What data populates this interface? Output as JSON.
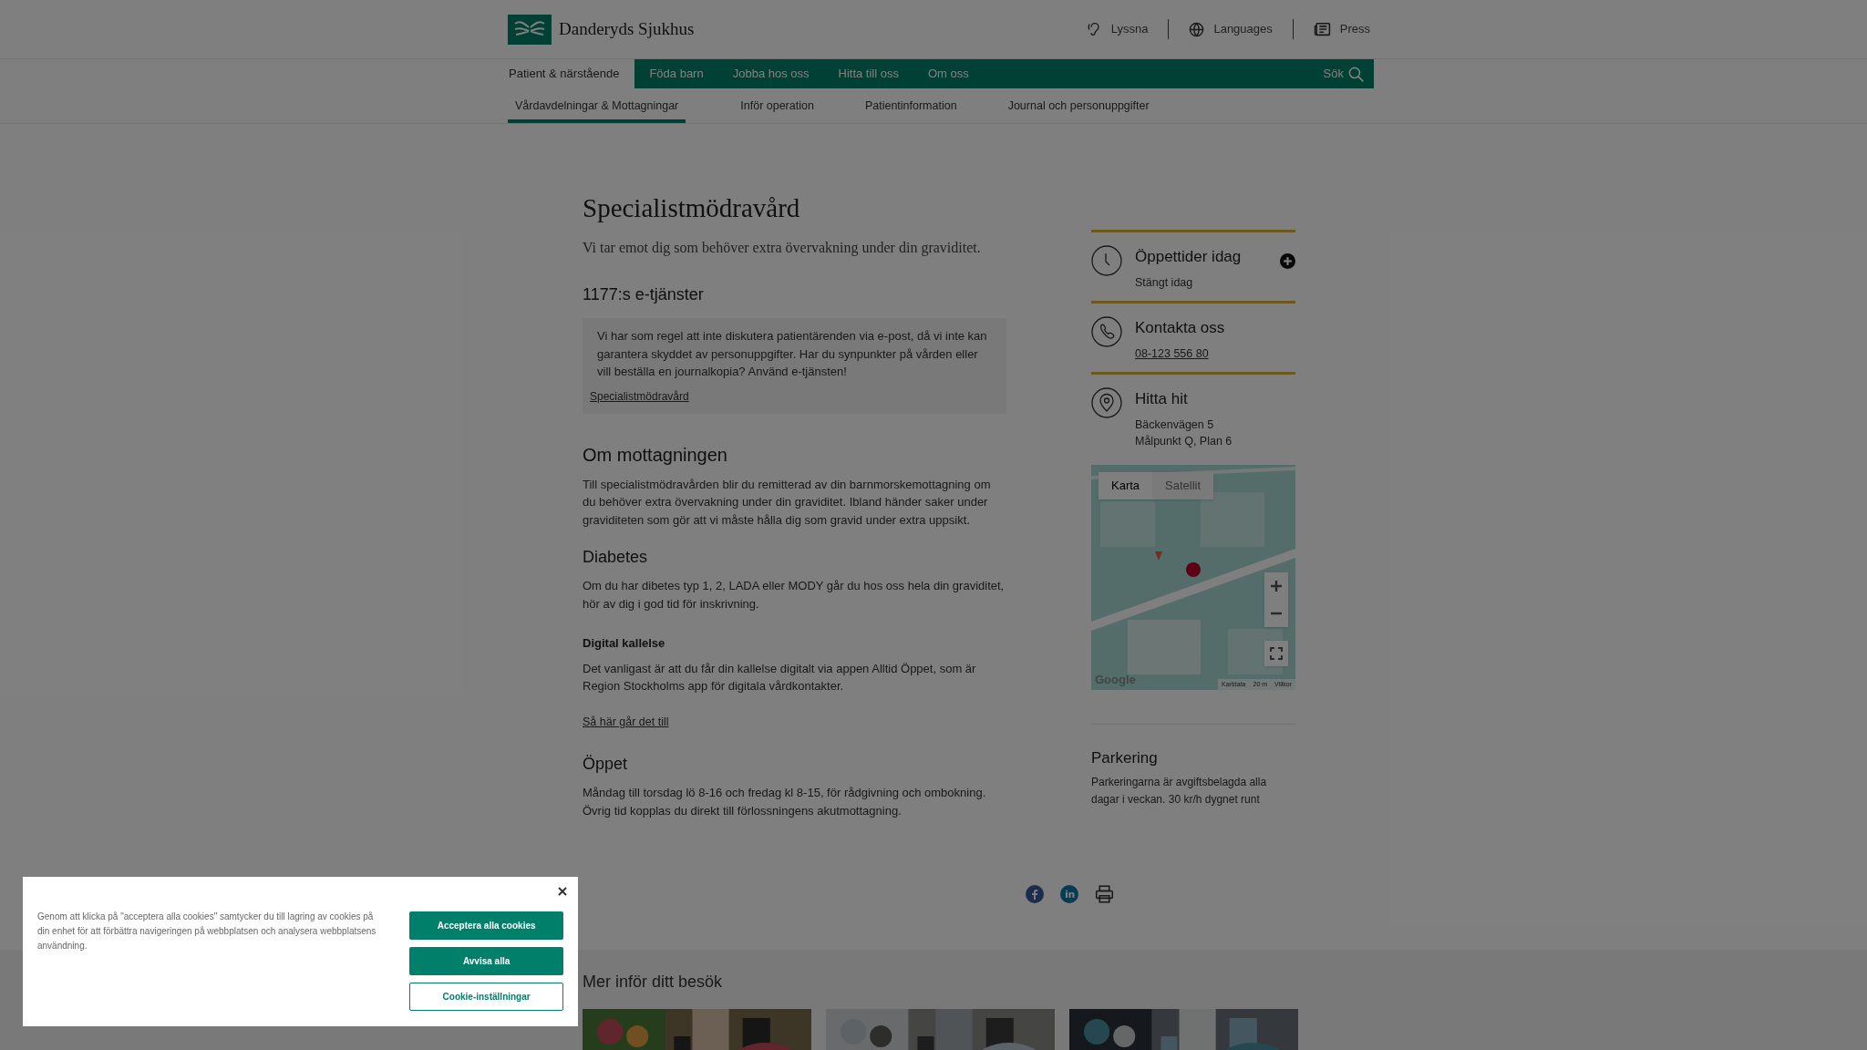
{
  "header": {
    "logo_text": "Danderyds Sjukhus",
    "utility_links": [
      {
        "kind": "ear",
        "label": "Lyssna"
      },
      {
        "kind": "globe",
        "label": "Languages"
      },
      {
        "kind": "newspaper",
        "label": "Press"
      }
    ]
  },
  "main_nav": {
    "items": [
      {
        "label": "Patient & närstående",
        "selected": true
      },
      {
        "label": "Föda barn",
        "selected": false
      },
      {
        "label": "Jobba hos oss",
        "selected": false
      },
      {
        "label": "Hitta till oss",
        "selected": false
      },
      {
        "label": "Om oss",
        "selected": false
      }
    ],
    "search_label": "Sök"
  },
  "sub_nav": {
    "items": [
      {
        "label": "Vårdavdelningar & Mottagningar",
        "selected": true
      },
      {
        "label": "Inför operation",
        "selected": false
      },
      {
        "label": "Patientinformation",
        "selected": false
      },
      {
        "label": "Journal och personuppgifter",
        "selected": false
      }
    ]
  },
  "article": {
    "title": "Specialistmödravård",
    "lead": "Vi tar emot dig som behöver extra övervakning under din graviditet.",
    "blocks": [
      {
        "kind": "h2",
        "text": "1177:s e-tjänster"
      },
      {
        "kind": "info_box",
        "text": "Vi har som regel att inte diskutera patientärenden via e-post, då vi inte kan garantera skyddet av personuppgifter. Har du synpunkter på vården eller vill beställa en journalkopia? Använd e-tjänsten!",
        "link": "Specialistmödravård"
      },
      {
        "kind": "h2",
        "text": "Om mottagningen"
      },
      {
        "kind": "p",
        "text": "Till specialistmödravården blir du remitterad av din barnmorskemottagning om du behöver extra övervakning under din graviditet. Ibland händer saker under graviditeten som gör att vi måste hålla dig som gravid under extra uppsikt."
      },
      {
        "kind": "h3",
        "text": "Diabetes"
      },
      {
        "kind": "p",
        "text": "Om du har dibetes typ 1, 2, LADA eller MODY går du hos oss hela din graviditet, hör av dig i god tid för inskrivning."
      },
      {
        "kind": "h4",
        "text": "Digital kallelse"
      },
      {
        "kind": "p",
        "text": "Det vanligast är att du får din kallelse digitalt via appen Alltid Öppet, som är Region Stockholms app för digitala vårdkontakter."
      },
      {
        "kind": "link",
        "text": "Så här går det till"
      },
      {
        "kind": "h3",
        "text": "Öppet"
      },
      {
        "kind": "p",
        "text": "Måndag till torsdag lö 8-16 och fredag kl 8-15, för rådgivning och ombokning. Övrig tid kopplas du direkt till förlossningens akutmottagning."
      }
    ]
  },
  "sidebar": {
    "cards": [
      {
        "kind": "hours",
        "title": "Öppettider idag",
        "lines": [
          "Stängt idag"
        ],
        "expanded": false
      },
      {
        "kind": "phone",
        "title": "Kontakta oss",
        "link": "08-123 556 80"
      },
      {
        "kind": "location",
        "title": "Hitta hit",
        "lines": [
          "Bäckenvägen 5",
          "Målpunkt Q, Plan 6"
        ]
      }
    ],
    "map": {
      "tabs": [
        {
          "label": "Karta",
          "selected": true
        },
        {
          "label": "Satellit",
          "selected": false
        }
      ],
      "logo": "Google",
      "attribution": [
        "Kartdata",
        "20 m",
        "Villkor"
      ]
    },
    "parking": {
      "title": "Parkering",
      "text": "Parkeringarna är avgiftsbelagda alla dagar i veckan. 30 kr/h dygnet runt"
    }
  },
  "related": {
    "title": "Mer inför ditt besök"
  },
  "cookie_banner": {
    "text": "Genom att klicka på \"acceptera alla cookies\" samtycker du till lagring av cookies på din enhet för att förbättra navigeringen på webbplatsen och analysera webbplatsens användning.",
    "buttons": [
      {
        "kind": "primary",
        "label": "Acceptera alla cookies"
      },
      {
        "kind": "primary",
        "label": "Avvisa alla"
      },
      {
        "kind": "outline",
        "label": "Cookie-inställningar"
      }
    ]
  }
}
